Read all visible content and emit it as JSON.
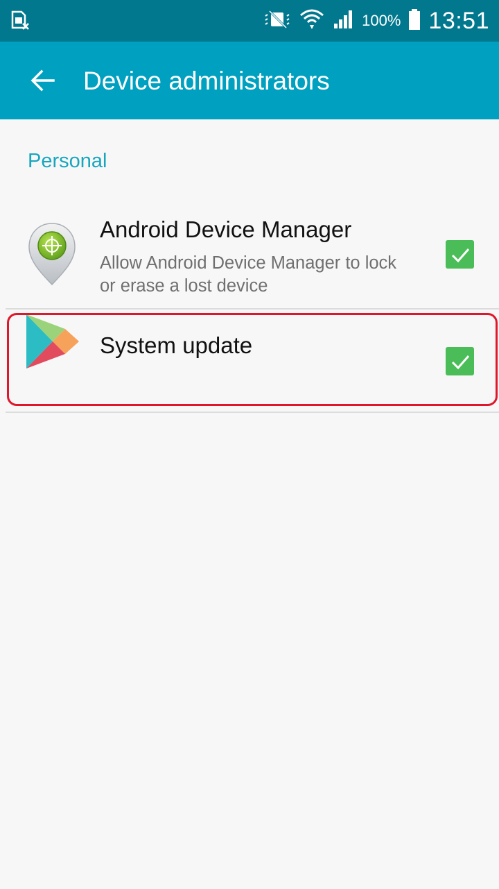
{
  "status_bar": {
    "battery_percent": "100%",
    "time": "13:51"
  },
  "app_bar": {
    "title": "Device administrators"
  },
  "section": {
    "label": "Personal"
  },
  "items": [
    {
      "title": "Android Device Manager",
      "summary": "Allow Android Device Manager to lock or erase a lost device",
      "checked": true,
      "icon": "android-device-manager-icon"
    },
    {
      "title": "System update",
      "summary": "",
      "checked": true,
      "icon": "play-store-icon"
    }
  ],
  "colors": {
    "status_bar": "#02788f",
    "app_bar": "#00a0c0",
    "accent": "#18a6bf",
    "checkbox": "#4bbd58",
    "highlight": "#e0162b"
  }
}
